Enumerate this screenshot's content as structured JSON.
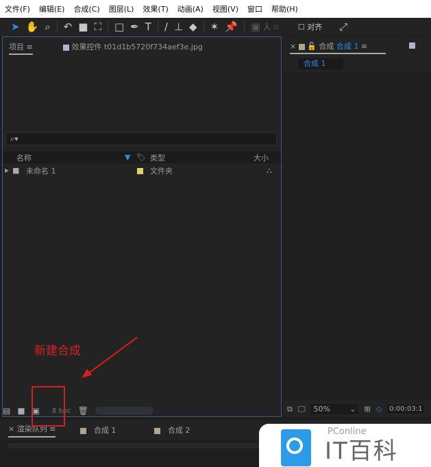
{
  "menu": [
    "文件(F)",
    "编辑(E)",
    "合成(C)",
    "图层(L)",
    "效果(T)",
    "动画(A)",
    "视图(V)",
    "窗口",
    "帮助(H)"
  ],
  "toolbar": {
    "align_label": "对齐"
  },
  "project": {
    "tab_label": "项目",
    "effects_tab": "效果控件 t01d1b5720f734aef3e.jpg",
    "search_placeholder": "⌕▾",
    "columns": {
      "name": "名称",
      "type": "类型",
      "size": "大小"
    },
    "rows": [
      {
        "name": "未命名 1",
        "type": "文件夹"
      }
    ],
    "bpc": "8 bpc"
  },
  "comp_panel": {
    "tab_prefix": "合成",
    "tab_name": "合成 1",
    "breadcrumb": "合成 1",
    "zoom": "50%",
    "timecode": "0:00:03:1"
  },
  "bottom_tabs": {
    "render_queue": "渲染队列",
    "comp1": "合成 1",
    "comp2": "合成 2"
  },
  "annotation": "新建合成",
  "logo": {
    "brand": "PConline",
    "name": "IT百科"
  },
  "colors": {
    "accent": "#2d8ceb",
    "annotation": "#d42020",
    "swatch_tan": "#b5a48a",
    "swatch_lavender": "#b4b0d8",
    "folder_label": "#e0d070"
  }
}
